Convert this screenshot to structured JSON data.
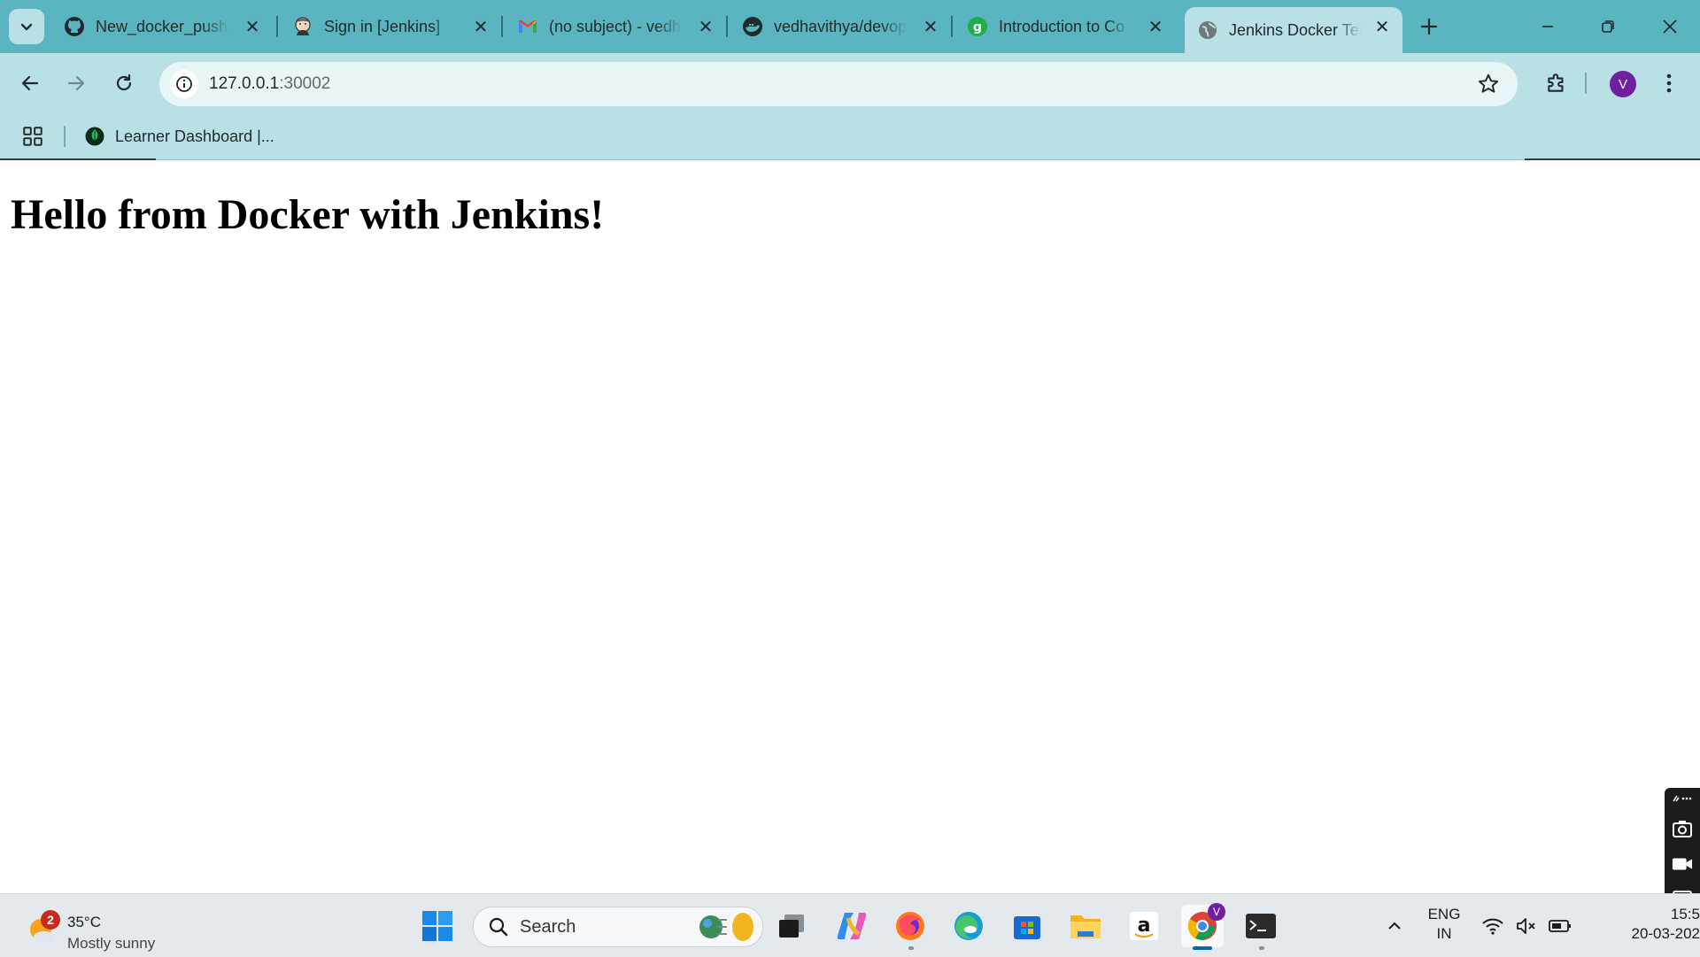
{
  "browser": {
    "tabs": [
      {
        "title": "New_docker_push/",
        "icon": "github-icon",
        "active": false
      },
      {
        "title": "Sign in [Jenkins]",
        "icon": "jenkins-icon",
        "active": false
      },
      {
        "title": "(no subject) - vedh",
        "icon": "gmail-icon",
        "active": false
      },
      {
        "title": "vedhavithya/devop",
        "icon": "docker-hub-icon",
        "active": false
      },
      {
        "title": "Introduction to Co",
        "icon": "course-icon",
        "active": false
      },
      {
        "title": "Jenkins Docker Tes",
        "icon": "globe-icon",
        "active": true
      }
    ],
    "address": {
      "host": "127.0.0.1",
      "port": ":30002"
    },
    "profile_initial": "V",
    "bookmarks": [
      {
        "label": "Learner Dashboard |...",
        "icon": "mongodb-leaf-icon"
      }
    ]
  },
  "page": {
    "heading": "Hello from Docker with Jenkins!"
  },
  "taskbar": {
    "weather": {
      "temp": "35°C",
      "condition": "Mostly sunny",
      "badge": "2"
    },
    "search_label": "Search",
    "language": {
      "line1": "ENG",
      "line2": "IN"
    },
    "clock": {
      "time": "15:5",
      "date": "20-03-202"
    },
    "chrome_profile_badge": "V"
  },
  "colors": {
    "tabstrip": "#5bb5c0",
    "toolbar": "#b9e0e4",
    "avatar": "#6f1fa0",
    "taskbar": "#e4e9ee"
  }
}
